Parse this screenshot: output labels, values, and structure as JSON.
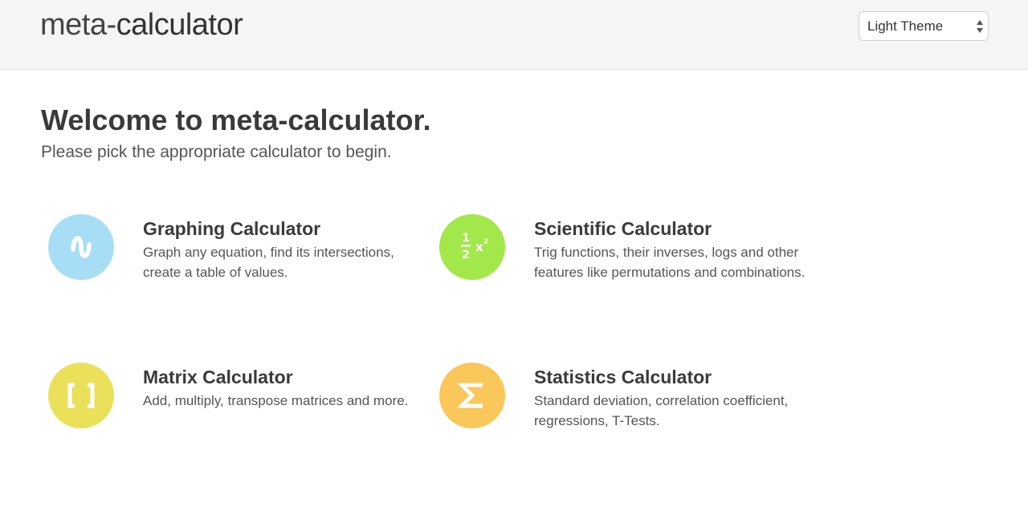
{
  "header": {
    "logo_light": "meta-",
    "logo_bold": "calculator",
    "theme_select": {
      "value": "Light Theme"
    }
  },
  "main": {
    "title": "Welcome to meta-calculator.",
    "subtitle": "Please pick the appropriate calculator to begin."
  },
  "calculators": [
    {
      "title": "Graphing Calculator",
      "description": "Graph any equation, find its intersections, create a table of values.",
      "icon": "wave-icon",
      "color": "#a8def5"
    },
    {
      "title": "Scientific Calculator",
      "description": "Trig functions, their inverses, logs and other features like permutations and combinations.",
      "icon": "fraction-power-icon",
      "color": "#a3e84a"
    },
    {
      "title": "Matrix Calculator",
      "description": "Add, multiply, transpose matrices and more.",
      "icon": "brackets-icon",
      "color": "#ebe05a"
    },
    {
      "title": "Statistics Calculator",
      "description": "Standard deviation, correlation coefficient, regressions, T-Tests.",
      "icon": "sigma-icon",
      "color": "#f9c75a"
    }
  ]
}
